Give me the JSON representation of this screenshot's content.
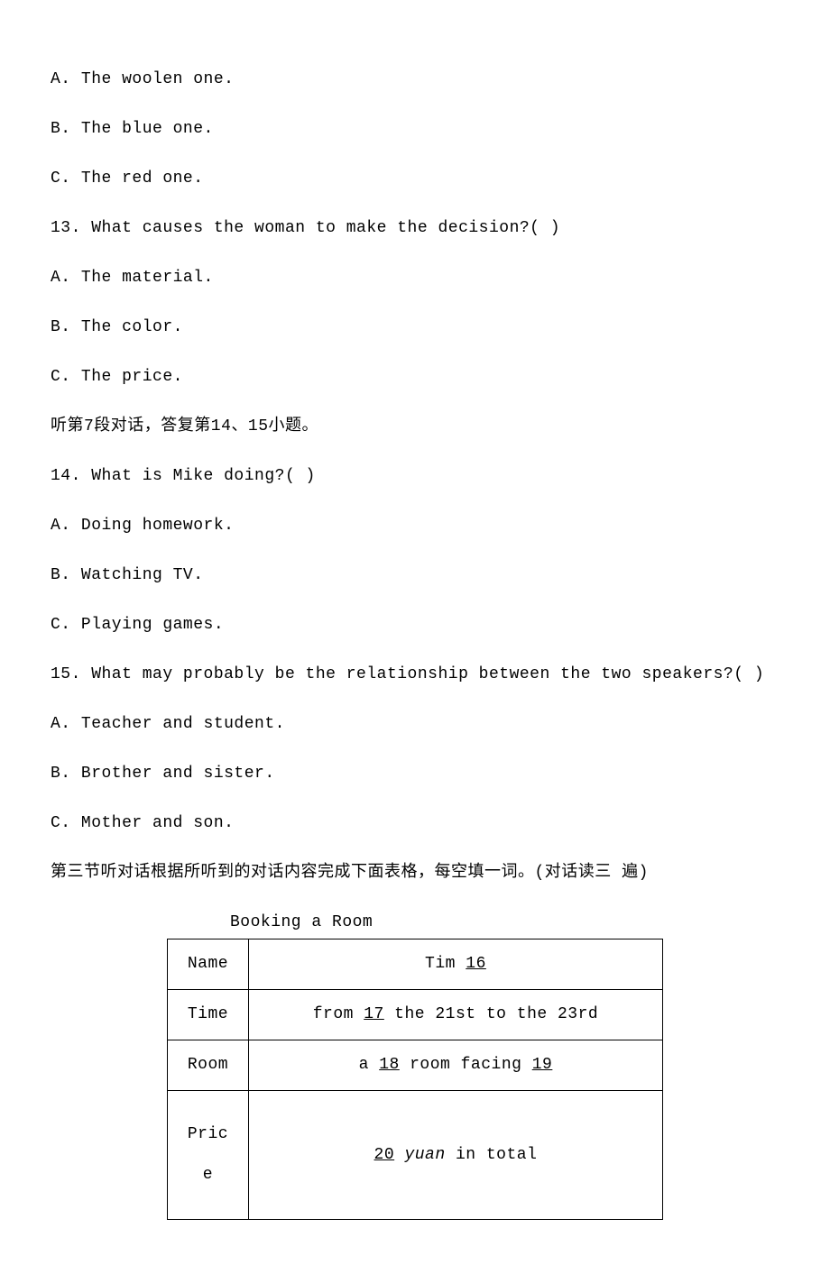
{
  "options_top": [
    "A. The woolen one.",
    "B. The blue one.",
    "C. The red one."
  ],
  "q13": {
    "question": "13. What causes the woman to make the decision?(        )",
    "options": [
      "A. The material.",
      "B. The color.",
      "C. The price."
    ]
  },
  "section_note_7": "听第7段对话，答复第14、15小题。",
  "q14": {
    "question": "14. What is Mike doing?(      )",
    "options": [
      "A. Doing homework.",
      "B. Watching TV.",
      "C. Playing games."
    ]
  },
  "q15": {
    "question": "15. What may probably be the relationship between the two speakers?(        )",
    "options": [
      "A. Teacher and student.",
      "B. Brother and sister.",
      "C. Mother and son."
    ]
  },
  "section3_heading": "第三节听对话根据所听到的对话内容完成下面表格，每空填一词。(对话读三 遍)",
  "table": {
    "title": "Booking a Room",
    "rows": {
      "name": {
        "label": "Name",
        "prefix": "Tim ",
        "blank": "16",
        "suffix": ""
      },
      "time": {
        "label": "Time",
        "prefix": "from ",
        "blank": "17",
        "suffix": " the 21st to the 23rd"
      },
      "room": {
        "label": "Room",
        "prefix": "a ",
        "blank1": "18",
        "middle": " room facing ",
        "blank2": "19"
      },
      "price": {
        "label": "Pric\ne",
        "blank": "20",
        "yuan": " yuan",
        "suffix": " in total"
      },
      "price_label_line1": "Pric",
      "price_label_line2": "e"
    }
  }
}
